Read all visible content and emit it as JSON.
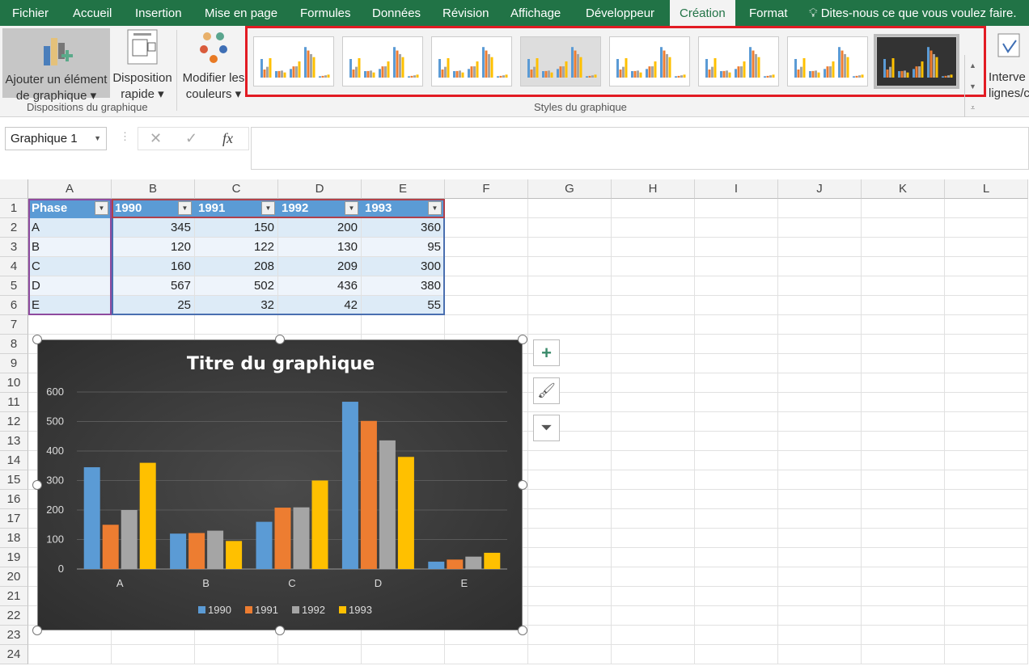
{
  "tabs": [
    {
      "label": "Fichier"
    },
    {
      "label": "Accueil"
    },
    {
      "label": "Insertion"
    },
    {
      "label": "Mise en page"
    },
    {
      "label": "Formules"
    },
    {
      "label": "Données"
    },
    {
      "label": "Révision"
    },
    {
      "label": "Affichage"
    },
    {
      "label": "Développeur"
    },
    {
      "label": "Création",
      "active": true
    },
    {
      "label": "Format"
    }
  ],
  "tell_me": "Dites-nous ce que vous voulez faire.",
  "ribbon": {
    "add_element": [
      "Ajouter un élément",
      "de graphique"
    ],
    "quick_layout": [
      "Disposition",
      "rapide"
    ],
    "colors": [
      "Modifier les",
      "couleurs"
    ],
    "switch": [
      "Interve",
      "lignes/c"
    ],
    "group_layouts": "Dispositions du graphique",
    "group_styles": "Styles du graphique",
    "style_count": 8,
    "selected_style": 8
  },
  "formula_bar": {
    "name_box": "Graphique 1",
    "cancel": "✕",
    "enter": "✓",
    "fx": "fx",
    "value": ""
  },
  "columns": [
    "A",
    "B",
    "C",
    "D",
    "E",
    "F",
    "G",
    "H",
    "I",
    "J",
    "K",
    "L"
  ],
  "rows": [
    "1",
    "2",
    "3",
    "4",
    "5",
    "6",
    "7",
    "8",
    "9",
    "10",
    "11",
    "12",
    "13",
    "14",
    "15",
    "16",
    "17",
    "18",
    "19",
    "20",
    "21",
    "22",
    "23",
    "24"
  ],
  "table": {
    "headers": [
      "Phase",
      "1990",
      "1991",
      "1992",
      "1993"
    ],
    "rows": [
      [
        "A",
        "345",
        "150",
        "200",
        "360"
      ],
      [
        "B",
        "120",
        "122",
        "130",
        "95"
      ],
      [
        "C",
        "160",
        "208",
        "209",
        "300"
      ],
      [
        "D",
        "567",
        "502",
        "436",
        "380"
      ],
      [
        "E",
        "25",
        "32",
        "42",
        "55"
      ]
    ]
  },
  "chart_data": {
    "type": "bar",
    "title": "Titre du graphique",
    "categories": [
      "A",
      "B",
      "C",
      "D",
      "E"
    ],
    "series": [
      {
        "name": "1990",
        "values": [
          345,
          120,
          160,
          567,
          25
        ],
        "color": "#5b9bd5"
      },
      {
        "name": "1991",
        "values": [
          150,
          122,
          208,
          502,
          32
        ],
        "color": "#ed7d31"
      },
      {
        "name": "1992",
        "values": [
          200,
          130,
          209,
          436,
          42
        ],
        "color": "#a5a5a5"
      },
      {
        "name": "1993",
        "values": [
          360,
          95,
          300,
          380,
          55
        ],
        "color": "#ffc000"
      }
    ],
    "ylim": [
      0,
      600
    ],
    "yticks": [
      "0",
      "100",
      "200",
      "300",
      "400",
      "500",
      "600"
    ],
    "grid": true,
    "legend": "bottom"
  },
  "side_buttons": [
    "plus-icon",
    "brush-icon",
    "filter-icon"
  ]
}
